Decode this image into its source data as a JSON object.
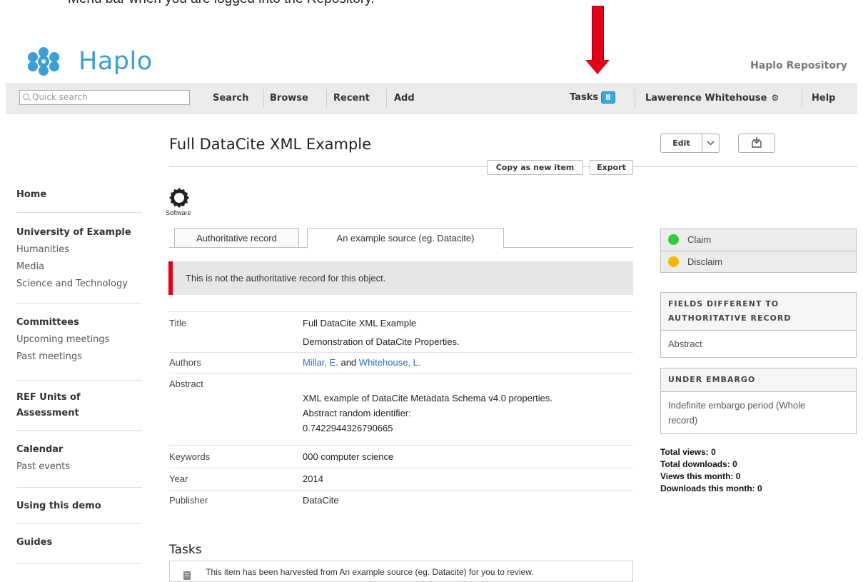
{
  "doc_caption": "Menu bar when you are logged into the Repository.",
  "header": {
    "logo_text": "Haplo",
    "repository_name": "Haplo Repository"
  },
  "navbar": {
    "search_placeholder": "Quick search",
    "links": {
      "search": "Search",
      "browse": "Browse",
      "recent": "Recent",
      "add": "Add"
    },
    "tasks_label": "Tasks",
    "tasks_count": "8",
    "user_name": "Lawerence Whitehouse",
    "help": "Help"
  },
  "sidebar": {
    "home": "Home",
    "university": "University of Example",
    "humanities": "Humanities",
    "media": "Media",
    "science": "Science and Technology",
    "committees": "Committees",
    "upcoming_meetings": "Upcoming meetings",
    "past_meetings": "Past meetings",
    "ref_units_line1": "REF Units of",
    "ref_units_line2": "Assessment",
    "calendar": "Calendar",
    "past_events": "Past events",
    "using_demo": "Using this demo",
    "guides": "Guides"
  },
  "main": {
    "title": "Full DataCite XML Example",
    "edit_label": "Edit",
    "copy_label": "Copy as new item",
    "export_label": "Export",
    "type_label": "Software",
    "tabs": [
      "Authoritative record",
      "An example source (eg. Datacite)"
    ],
    "notice": "This is not the authoritative record for this object.",
    "fields": {
      "title_label": "Title",
      "title_value": "Full DataCite XML Example",
      "title_alt": "Demonstration of DataCite Properties.",
      "authors_label": "Authors",
      "author1": "Millar, E.",
      "authors_and": "and",
      "author2": "Whitehouse, L.",
      "abstract_label": "Abstract",
      "abstract_line1": "XML example of DataCite Metadata Schema v4.0 properties.",
      "abstract_line2": "Abstract random identifier:",
      "abstract_line3": "0.7422944326790665",
      "keywords_label": "Keywords",
      "keywords_value": "000 computer science",
      "year_label": "Year",
      "year_value": "2014",
      "publisher_label": "Publisher",
      "publisher_value": "DataCite"
    },
    "tasks_heading": "Tasks",
    "task_text": "This item has been harvested from An example source (eg. Datacite) for you to review."
  },
  "right_panel": {
    "claim": "Claim",
    "disclaim": "Disclaim",
    "fields_diff_head_line1": "FIELDS DIFFERENT TO",
    "fields_diff_head_line2": "AUTHORITATIVE RECORD",
    "fields_diff_value": "Abstract",
    "embargo_head": "UNDER EMBARGO",
    "embargo_line1": "Indefinite embargo period (Whole",
    "embargo_line2": "record)",
    "stats": {
      "total_views": "Total views: 0",
      "total_downloads": "Total downloads: 0",
      "views_month": "Views this month: 0",
      "downloads_month": "Downloads this month: 0"
    }
  },
  "colors": {
    "brand": "#3a9fd6",
    "arrow": "#e3001b",
    "claim_dot": "#2ecc40",
    "disclaim_dot": "#f5b800",
    "tasks_badge": "#3aa8e0",
    "link": "#2a6fbf"
  }
}
